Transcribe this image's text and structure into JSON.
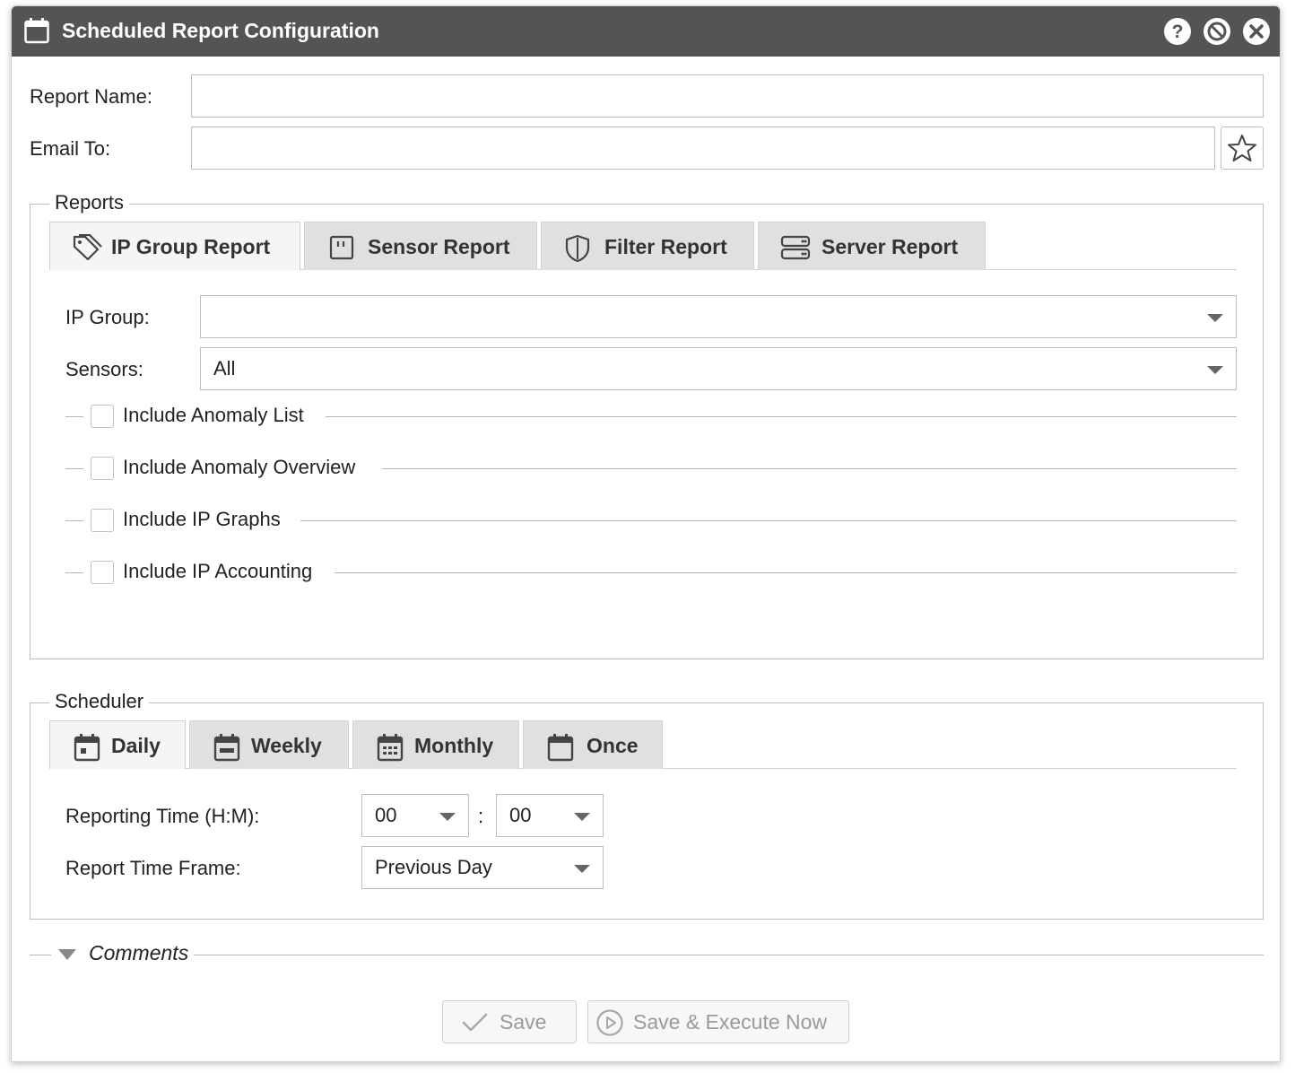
{
  "window": {
    "title": "Scheduled Report Configuration",
    "icons": [
      "calendar-icon",
      "help-icon",
      "minimize-icon",
      "close-icon"
    ]
  },
  "form": {
    "report_name_label": "Report Name:",
    "report_name_value": "",
    "email_to_label": "Email To:",
    "email_to_value": ""
  },
  "reports": {
    "legend": "Reports",
    "tabs": [
      {
        "label": "IP Group Report",
        "icon": "tag-icon",
        "active": true
      },
      {
        "label": "Sensor Report",
        "icon": "sensor-icon",
        "active": false
      },
      {
        "label": "Filter Report",
        "icon": "shield-icon",
        "active": false
      },
      {
        "label": "Server Report",
        "icon": "server-icon",
        "active": false
      }
    ],
    "ip_group_label": "IP Group:",
    "ip_group_value": "",
    "sensors_label": "Sensors:",
    "sensors_value": "All",
    "checkboxes": [
      {
        "label": "Include Anomaly List",
        "checked": false
      },
      {
        "label": "Include Anomaly Overview",
        "checked": false
      },
      {
        "label": "Include IP Graphs",
        "checked": false
      },
      {
        "label": "Include IP Accounting",
        "checked": false
      }
    ]
  },
  "scheduler": {
    "legend": "Scheduler",
    "tabs": [
      {
        "label": "Daily",
        "icon": "calendar-day-icon",
        "active": true
      },
      {
        "label": "Weekly",
        "icon": "calendar-week-icon",
        "active": false
      },
      {
        "label": "Monthly",
        "icon": "calendar-month-icon",
        "active": false
      },
      {
        "label": "Once",
        "icon": "calendar-icon",
        "active": false
      }
    ],
    "reporting_time_label": "Reporting Time (H:M):",
    "hour_value": "00",
    "time_separator": ":",
    "minute_value": "00",
    "time_frame_label": "Report Time Frame:",
    "time_frame_value": "Previous Day"
  },
  "comments": {
    "label": "Comments"
  },
  "buttons": {
    "save_label": "Save",
    "save_execute_label": "Save & Execute Now"
  }
}
